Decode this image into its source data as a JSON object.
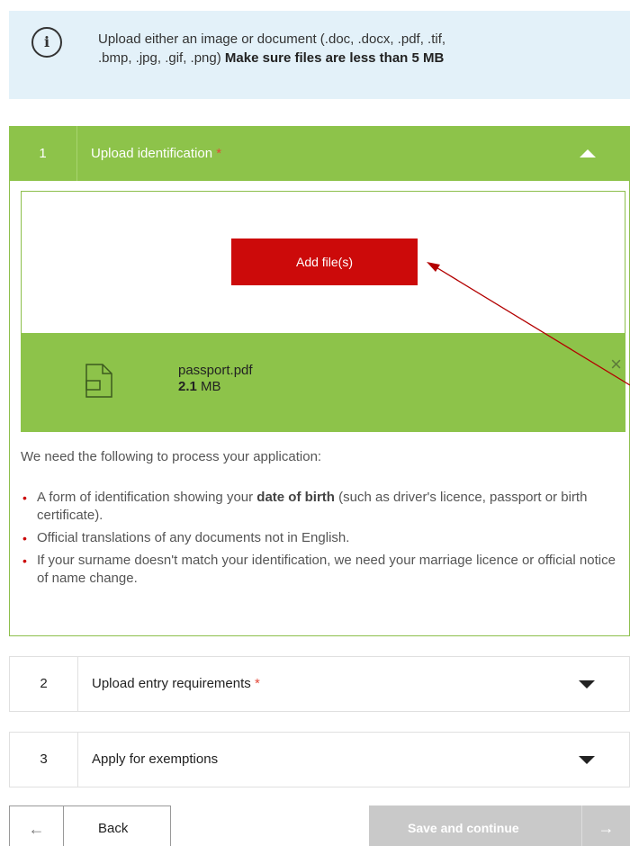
{
  "info": {
    "icon": "info-icon",
    "icon_glyph": "i",
    "text_line1": "Upload either an image or document (.doc, .docx, .pdf, .tif,",
    "text_line2_plain": ".bmp, .jpg, .gif, .png) ",
    "text_line2_bold": "Make sure files are less than 5 MB"
  },
  "sections": [
    {
      "number": "1",
      "title": "Upload identification",
      "required_mark": "*",
      "expanded": true,
      "add_button_label": "Add file(s)",
      "file": {
        "icon": "document-icon",
        "name": "passport.pdf",
        "size_value": "2.1",
        "size_unit": " MB",
        "remove_glyph": "×"
      },
      "requirements_intro": "We need the following to process your application:",
      "requirements": [
        {
          "pre": "A form of identification showing your ",
          "bold": "date of birth",
          "post": " (such as driver's licence, passport or birth certificate)."
        },
        {
          "pre": "Official translations of any documents not in English.",
          "bold": "",
          "post": ""
        },
        {
          "pre": "If your surname doesn't match your identification, we need your marriage licence or official notice of name change.",
          "bold": "",
          "post": ""
        }
      ]
    },
    {
      "number": "2",
      "title": "Upload entry requirements",
      "required_mark": "*",
      "expanded": false
    },
    {
      "number": "3",
      "title": "Apply for exemptions",
      "expanded": false
    }
  ],
  "footer": {
    "back_arrow": "←",
    "back_label": "Back",
    "save_label": "Save and continue",
    "save_arrow": "→"
  },
  "colors": {
    "green": "#8dc34a",
    "red": "#cc0a0a",
    "info_bg": "#e3f1f9",
    "disabled": "#c9c9c9",
    "annotation": "#b30000"
  }
}
